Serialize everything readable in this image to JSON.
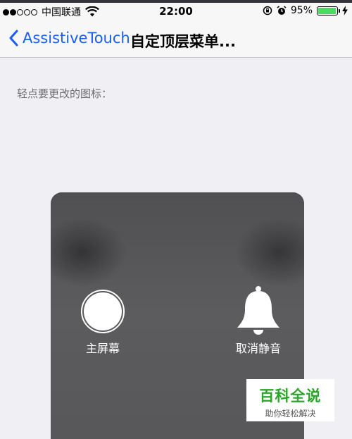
{
  "status_bar": {
    "carrier": "中国联通",
    "time": "22:00",
    "battery_percent": "95%",
    "battery_level": 0.95,
    "signal_filled": 2,
    "signal_total": 5
  },
  "nav": {
    "back_label": "AssistiveTouch",
    "title": "自定顶层菜单..."
  },
  "content": {
    "section_label": "轻点要更改的图标：",
    "menu_items": [
      {
        "label": "主屏幕",
        "icon": "home-button-icon"
      },
      {
        "label": "取消静音",
        "icon": "bell-icon"
      }
    ]
  },
  "watermark": {
    "title": "百科全说",
    "subtitle": "助你轻松解决"
  },
  "colors": {
    "accent": "#1a5ef0",
    "battery": "#4cd964",
    "background": "#efeff4",
    "panel": "#5a5a5c",
    "watermark_green": "#2aa52a"
  }
}
